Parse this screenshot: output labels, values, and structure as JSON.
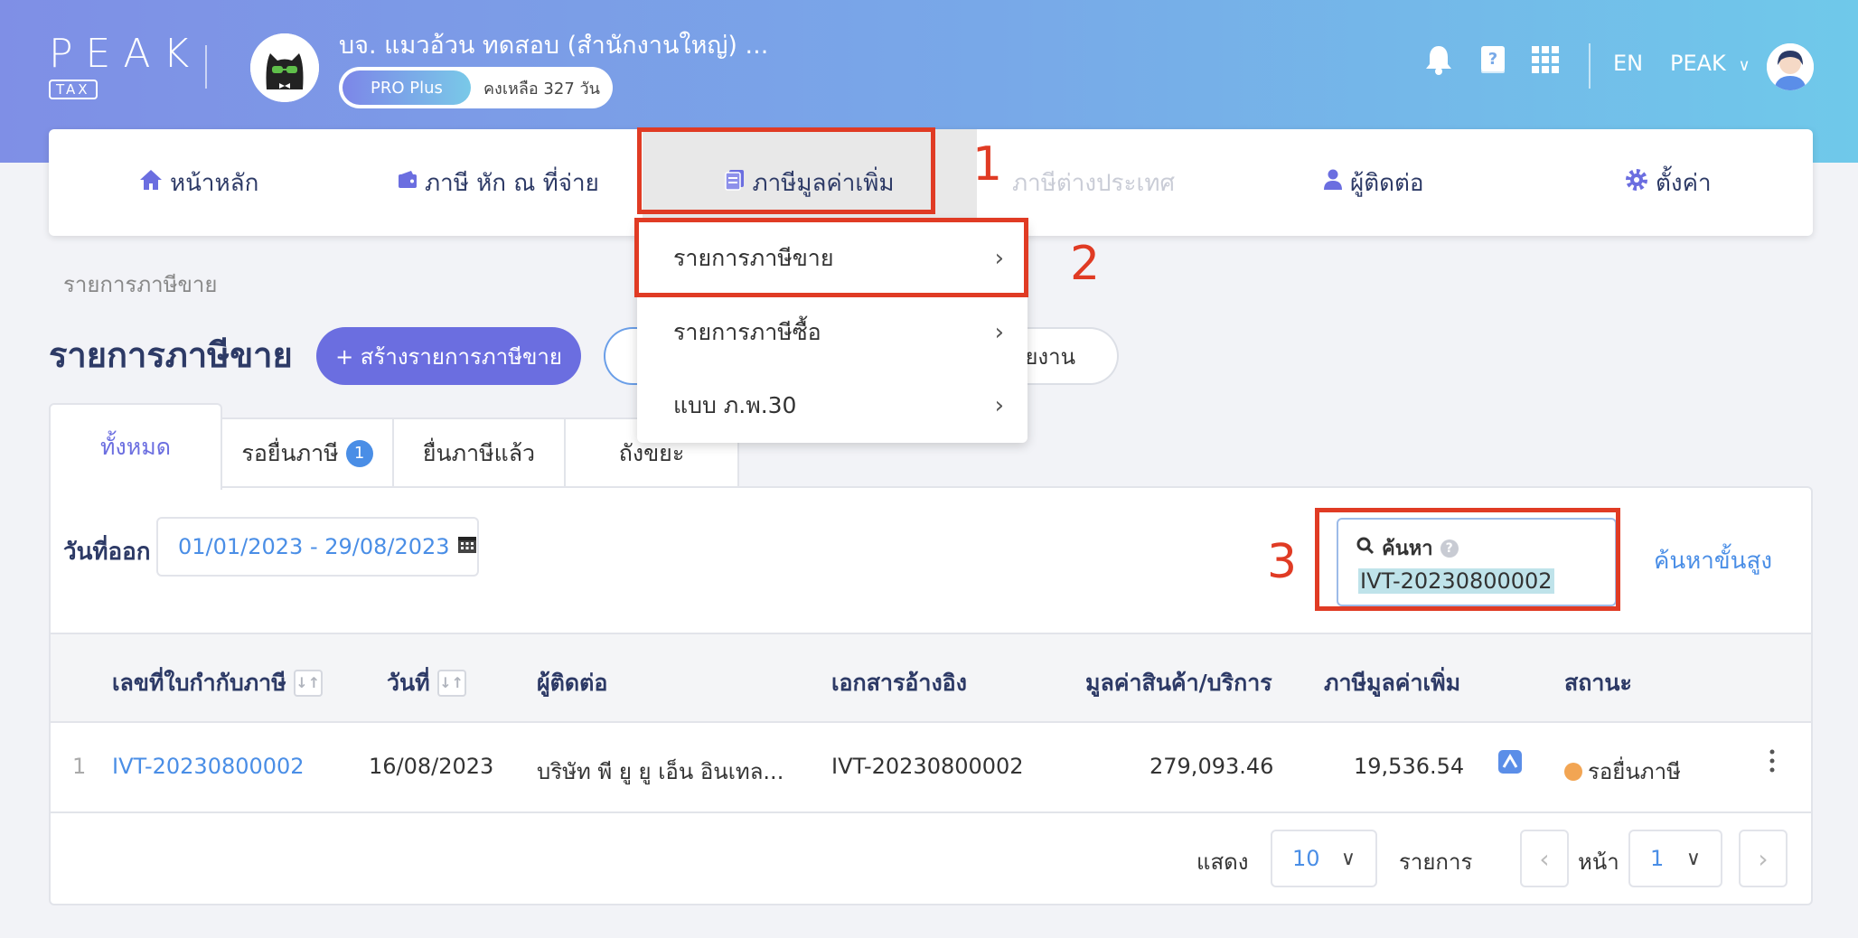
{
  "header": {
    "logo": "PEAK",
    "logo_sub": "TAX",
    "company_name": "บจ. แมวอ้วน ทดสอบ (สำนักงานใหญ่) ...",
    "plan_name": "PRO Plus",
    "plan_remaining": "คงเหลือ 327 วัน",
    "language": "EN",
    "user_name": "PEAK"
  },
  "nav": {
    "items": [
      {
        "label": "หน้าหลัก",
        "icon": "home-icon"
      },
      {
        "label": "ภาษี หัก ณ ที่จ่าย",
        "icon": "wallet-icon"
      },
      {
        "label": "ภาษีมูลค่าเพิ่ม",
        "icon": "document-icon"
      },
      {
        "label": "ภาษีต่างประเทศ",
        "icon": ""
      },
      {
        "label": "ผู้ติดต่อ",
        "icon": "person-icon"
      },
      {
        "label": "ตั้งค่า",
        "icon": "gear-icon"
      }
    ]
  },
  "dropdown": {
    "items": [
      {
        "label": "รายการภาษีขาย"
      },
      {
        "label": "รายการภาษีซื้อ"
      },
      {
        "label": "แบบ ภ.พ.30"
      }
    ]
  },
  "annotations": [
    "1",
    "2",
    "3"
  ],
  "page": {
    "breadcrumb": "รายการภาษีขาย",
    "title": "รายการภาษีขาย",
    "create_button": "+ สร้างรายการภาษีขาย",
    "report_button_partial": "ยงาน"
  },
  "tabs": [
    {
      "label": "ทั้งหมด"
    },
    {
      "label": "รอยื่นภาษี",
      "badge": "1"
    },
    {
      "label": "ยื่นภาษีแล้ว"
    },
    {
      "label": "ถังขยะ"
    }
  ],
  "filters": {
    "date_label": "วันที่ออก",
    "date_range": "01/01/2023 - 29/08/2023",
    "search_label": "ค้นหา",
    "search_help": "?",
    "search_value": "IVT-20230800002",
    "advanced_search": "ค้นหาขั้นสูง"
  },
  "table": {
    "columns": [
      "เลขที่ใบกำกับภาษี",
      "วันที่",
      "ผู้ติดต่อ",
      "เอกสารอ้างอิง",
      "มูลค่าสินค้า/บริการ",
      "ภาษีมูลค่าเพิ่ม",
      "สถานะ"
    ],
    "sort_glyph": "↓↑",
    "rows": [
      {
        "index": "1",
        "invoice_no": "IVT-20230800002",
        "date": "16/08/2023",
        "contact": "บริษัท พี ยู ยู เอ็น อินเทล...",
        "reference": "IVT-20230800002",
        "amount": "279,093.46",
        "vat": "19,536.54",
        "status": "รอยื่นภาษี"
      }
    ]
  },
  "pagination": {
    "show_label": "แสดง",
    "page_size": "10",
    "items_label": "รายการ",
    "page_label": "หน้า",
    "page": "1"
  },
  "colors": {
    "primary": "#6b6ee0",
    "link": "#4a8ee6",
    "annotation": "#e03b24",
    "status_pending": "#f2a553"
  }
}
